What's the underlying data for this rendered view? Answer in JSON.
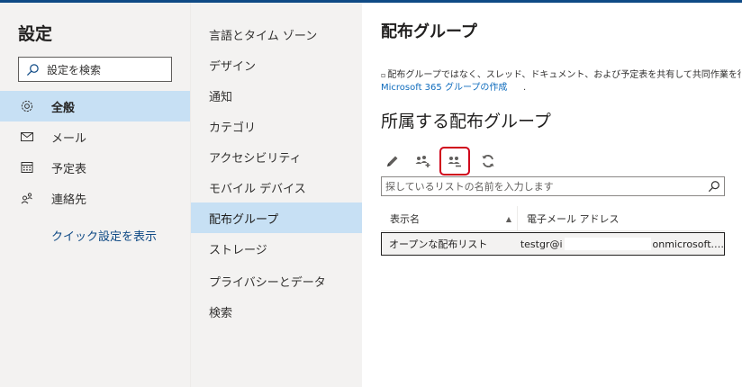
{
  "settings": {
    "title": "設定",
    "search_placeholder": "設定を検索",
    "categories": [
      {
        "label": "全般",
        "icon": "gear-icon",
        "active": true
      },
      {
        "label": "メール",
        "icon": "mail-icon",
        "active": false
      },
      {
        "label": "予定表",
        "icon": "calendar-icon",
        "active": false
      },
      {
        "label": "連絡先",
        "icon": "people-icon",
        "active": false
      }
    ],
    "quick_settings_link": "クイック設定を表示"
  },
  "subnav": {
    "items": [
      {
        "label": "言語とタイム ゾーン",
        "active": false
      },
      {
        "label": "デザイン",
        "active": false
      },
      {
        "label": "通知",
        "active": false
      },
      {
        "label": "カテゴリ",
        "active": false
      },
      {
        "label": "アクセシビリティ",
        "active": false
      },
      {
        "label": "モバイル デバイス",
        "active": false
      },
      {
        "label": "配布グループ",
        "active": true
      },
      {
        "label": "ストレージ",
        "active": false
      },
      {
        "label": "プライバシーとデータ",
        "active": false
      },
      {
        "label": "検索",
        "active": false
      }
    ]
  },
  "main": {
    "title": "配布グループ",
    "description": "配布グループではなく、スレッド、ドキュメント、および予定表を共有して共同作業を行う、",
    "link": "Microsoft 365 グループの作成",
    "link_suffix": ".",
    "section_title": "所属する配布グループ",
    "toolbar": [
      {
        "name": "edit-icon",
        "highlight": false
      },
      {
        "name": "join-group-icon",
        "highlight": false
      },
      {
        "name": "leave-group-icon",
        "highlight": true
      },
      {
        "name": "refresh-icon",
        "highlight": false
      }
    ],
    "filter_placeholder": "探しているリストの名前を入力します",
    "table": {
      "columns": [
        "表示名",
        "電子メール アドレス"
      ],
      "rows": [
        {
          "name": "オープンな配布リスト",
          "email_start": "testgr@i",
          "email_end": "onmicrosoft.…"
        }
      ]
    }
  },
  "colors": {
    "accent": "#0f4a85",
    "selected_bg": "#c7e0f4",
    "pane_bg": "#f3f2f1",
    "highlight_border": "#d0021b"
  }
}
